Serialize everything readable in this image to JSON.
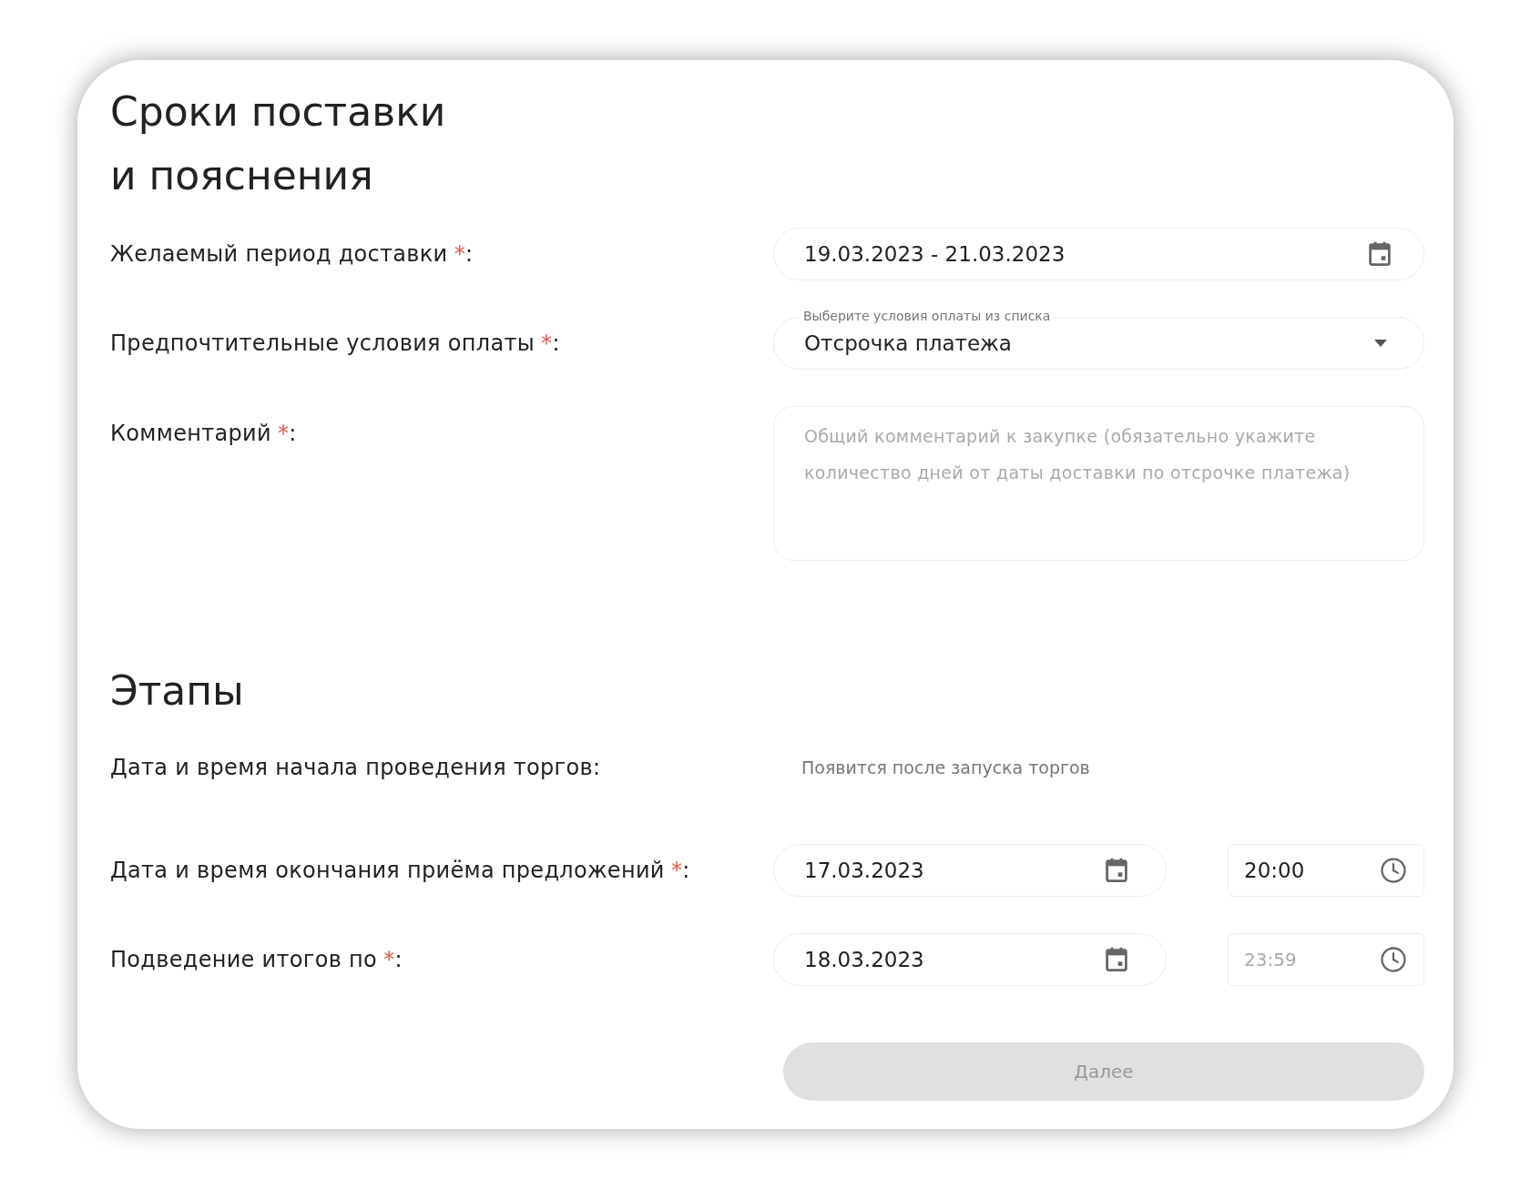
{
  "section_title_lines": [
    "Сроки поставки",
    "и пояснения"
  ],
  "delivery_fields": [
    {
      "kind": "date",
      "label": "Желаемый период доставки",
      "asterisk": "*",
      "colon": ":",
      "value": "19.03.2023 - 21.03.2023"
    },
    {
      "kind": "select",
      "label": "Предпочтительные условия оплаты",
      "asterisk": "*",
      "colon": ":",
      "floating_label": "Выберите условия оплаты из списка",
      "value": "Отсрочка платежа"
    },
    {
      "kind": "textarea",
      "label": "Комментарий",
      "asterisk": "*",
      "colon": ":",
      "placeholder": "Общий комментарий к закупке (обязательно укажите количество дней от даты доставки по отсрочке платежа)"
    }
  ],
  "stages_title": "Этапы",
  "stages": [
    {
      "kind": "info",
      "label": "Дата и время начала проведения торгов",
      "colon": ":",
      "note": "Появится после запуска торгов"
    },
    {
      "kind": "datetime",
      "label": "Дата и время окончания приёма предложений",
      "asterisk": "*",
      "colon": ":",
      "date": "17.03.2023",
      "time": "20:00"
    },
    {
      "kind": "datetime",
      "label": "Подведение итогов по",
      "asterisk": "*",
      "colon": ":",
      "date": "18.03.2023",
      "time_placeholder": "23:59"
    }
  ],
  "next_button": {
    "label": "Далее",
    "disabled": true
  }
}
